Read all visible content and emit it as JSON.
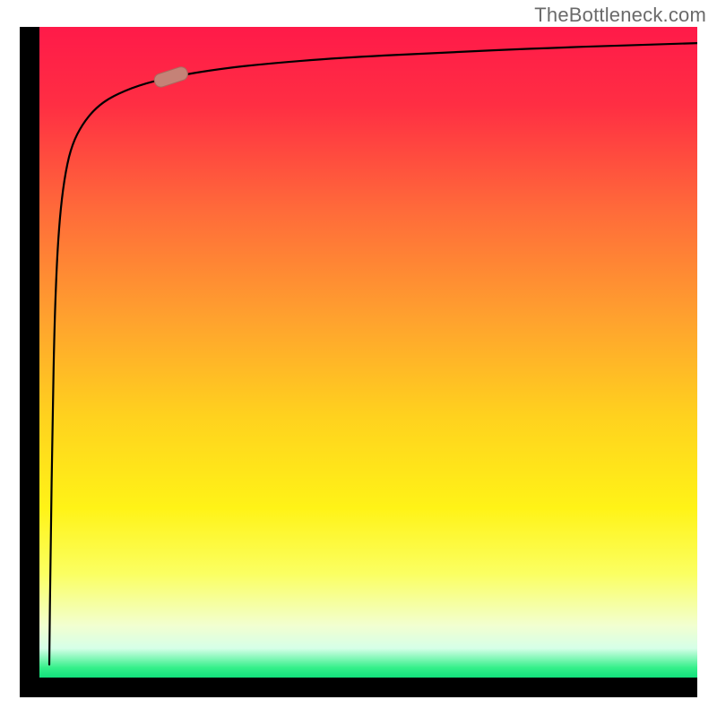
{
  "watermark": "TheBottleneck.com",
  "colors": {
    "frame": "#000000",
    "curve": "#000000",
    "marker_fill": "#c58277",
    "marker_stroke": "#a9695e",
    "grad_stops": [
      {
        "offset": 0.0,
        "color": "#ff1a49"
      },
      {
        "offset": 0.12,
        "color": "#ff2e43"
      },
      {
        "offset": 0.28,
        "color": "#ff6a3a"
      },
      {
        "offset": 0.45,
        "color": "#ffa22e"
      },
      {
        "offset": 0.6,
        "color": "#ffd21e"
      },
      {
        "offset": 0.74,
        "color": "#fff317"
      },
      {
        "offset": 0.84,
        "color": "#fbff61"
      },
      {
        "offset": 0.92,
        "color": "#f2ffd0"
      },
      {
        "offset": 0.955,
        "color": "#d6ffe8"
      },
      {
        "offset": 0.985,
        "color": "#34f08a"
      },
      {
        "offset": 1.0,
        "color": "#12e07c"
      }
    ]
  },
  "chart_data": {
    "type": "line",
    "title": "",
    "xlabel": "",
    "ylabel": "",
    "xlim": [
      0,
      100
    ],
    "ylim": [
      0,
      100
    ],
    "series": [
      {
        "name": "curve",
        "x": [
          1.5,
          1.7,
          2.0,
          2.3,
          2.7,
          3.2,
          4.0,
          5.0,
          6.5,
          8.5,
          11,
          15,
          20,
          27,
          35,
          45,
          60,
          78,
          100
        ],
        "values": [
          2,
          20,
          40,
          55,
          65,
          72,
          78,
          82,
          85,
          87.5,
          89.3,
          91,
          92.3,
          93.5,
          94.4,
          95.2,
          96.0,
          96.8,
          97.5
        ]
      }
    ],
    "marker": {
      "x": 20,
      "y": 92.3,
      "angle_deg": -18
    }
  }
}
